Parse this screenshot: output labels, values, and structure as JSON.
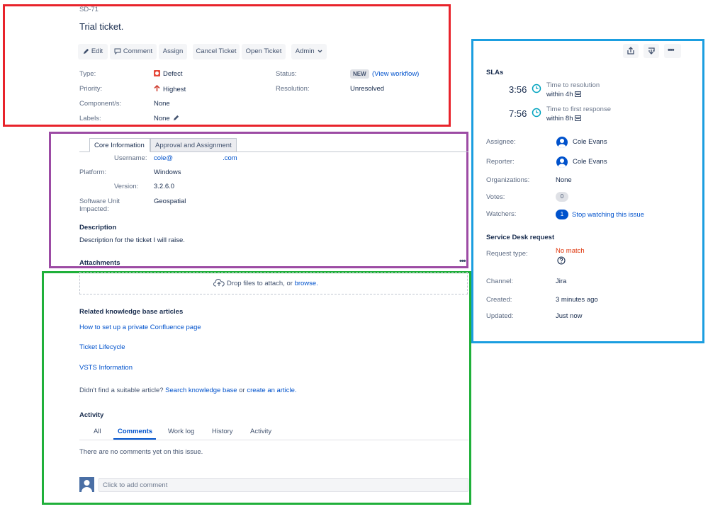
{
  "issue": {
    "key": "SD-71",
    "title": "Trial ticket."
  },
  "toolbar": {
    "edit": "Edit",
    "comment": "Comment",
    "assign": "Assign",
    "cancel_ticket": "Cancel Ticket",
    "open_ticket": "Open Ticket",
    "admin": "Admin"
  },
  "details": {
    "type_label": "Type:",
    "type_value": "Defect",
    "priority_label": "Priority:",
    "priority_value": "Highest",
    "components_label": "Component/s:",
    "components_value": "None",
    "labels_label": "Labels:",
    "labels_value": "None",
    "status_label": "Status:",
    "status_value": "NEW",
    "view_workflow": "(View workflow)",
    "resolution_label": "Resolution:",
    "resolution_value": "Unresolved"
  },
  "info_tabs": [
    "Core Information",
    "Approval and Assignment"
  ],
  "core": {
    "username_label": "Username:",
    "username_value_start": "cole@",
    "username_value_end": ".com",
    "platform_label": "Platform:",
    "platform_value": "Windows",
    "version_label": "Version:",
    "version_value": "3.2.6.0",
    "software_label_1": "Software Unit",
    "software_label_2": "Impacted:",
    "software_value": "Geospatial"
  },
  "description": {
    "title": "Description",
    "text": "Description for the ticket I will raise."
  },
  "attachments": {
    "title": "Attachments",
    "drop_text": "Drop files to attach, or",
    "browse": "browse."
  },
  "kb": {
    "title": "Related knowledge base articles",
    "articles": [
      "How to set up a private Confluence page",
      "Ticket Lifecycle",
      "VSTS Information"
    ],
    "not_found": "Didn't find a suitable article?",
    "search_link": "Search knowledge base",
    "or": "or",
    "create_link": "create an article."
  },
  "activity": {
    "title": "Activity",
    "tabs": [
      "All",
      "Comments",
      "Work log",
      "History",
      "Activity"
    ],
    "empty": "There are no comments yet on this issue.",
    "comment_placeholder": "Click to add comment"
  },
  "sla": {
    "title": "SLAs",
    "items": [
      {
        "time": "3:56",
        "name": "Time to resolution",
        "within": "within 4h"
      },
      {
        "time": "7:56",
        "name": "Time to first response",
        "within": "within 8h"
      }
    ]
  },
  "people": {
    "assignee_label": "Assignee:",
    "assignee": "Cole Evans",
    "reporter_label": "Reporter:",
    "reporter": "Cole Evans",
    "organizations_label": "Organizations:",
    "organizations": "None",
    "votes_label": "Votes:",
    "votes": "0",
    "watchers_label": "Watchers:",
    "watchers": "1",
    "stop_watching": "Stop watching this issue"
  },
  "service_desk": {
    "title": "Service Desk request",
    "request_type_label": "Request type:",
    "request_type": "No match",
    "channel_label": "Channel:",
    "channel": "Jira",
    "created_label": "Created:",
    "created": "3 minutes ago",
    "updated_label": "Updated:",
    "updated": "Just now"
  },
  "colors": {
    "red_box": "#e8232b",
    "purple_box": "#9c4ba4",
    "green_box": "#1fb03a",
    "blue_box": "#1b9ee0",
    "link": "#0052cc",
    "no_match": "#de350b",
    "sla_clock": "#00a3bf"
  }
}
